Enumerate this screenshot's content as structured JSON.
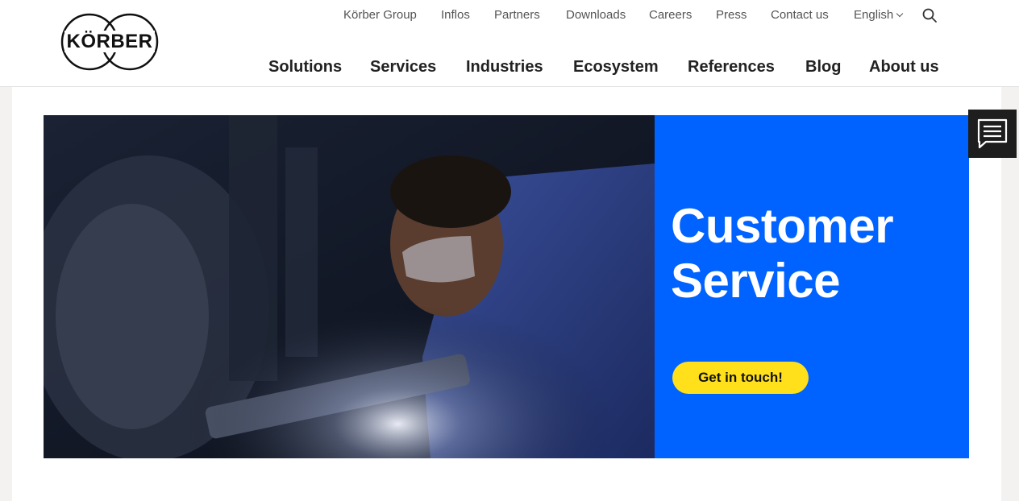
{
  "brand": {
    "logo_text": "KÖRBER"
  },
  "meta_nav": [
    {
      "label": "Körber Group"
    },
    {
      "label": "Inflos"
    },
    {
      "label": "Partners"
    },
    {
      "label": "Downloads"
    },
    {
      "label": "Careers"
    },
    {
      "label": "Press"
    },
    {
      "label": "Contact us"
    }
  ],
  "language": {
    "label": "English"
  },
  "main_nav": [
    {
      "label": "Solutions"
    },
    {
      "label": "Services"
    },
    {
      "label": "Industries"
    },
    {
      "label": "Ecosystem"
    },
    {
      "label": "References"
    },
    {
      "label": "Blog"
    },
    {
      "label": "About us"
    }
  ],
  "hero": {
    "title_line1": "Customer",
    "title_line2": "Service",
    "cta_label": "Get in touch!"
  },
  "icons": {
    "search": "search-icon",
    "chat": "chat-icon",
    "chevron": "chevron-down-icon"
  },
  "colors": {
    "accent_blue": "#0062ff",
    "cta_yellow": "#ffe01b",
    "chat_bg": "#1e1e1e"
  }
}
